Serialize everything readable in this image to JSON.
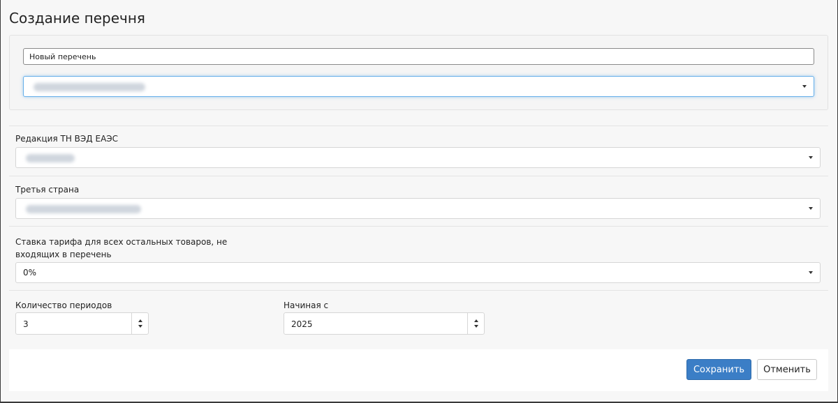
{
  "dialog": {
    "title": "Создание перечня"
  },
  "list_name": {
    "value": "Новый перечень"
  },
  "fields": {
    "edition": {
      "label": "Редакция ТН ВЭД ЕАЭС"
    },
    "country": {
      "label": "Третья страна"
    },
    "rate": {
      "label_line1": "Ставка тарифа для всех остальных товаров, не",
      "label_line2": "входящих в перечень",
      "value": "0%"
    },
    "periods": {
      "label": "Количество периодов",
      "value": "3"
    },
    "start": {
      "label": "Начиная с",
      "value": "2025"
    }
  },
  "buttons": {
    "save": "Сохранить",
    "cancel": "Отменить"
  },
  "colors": {
    "primary": "#3b7ec6",
    "focus_border": "#66afe9"
  }
}
